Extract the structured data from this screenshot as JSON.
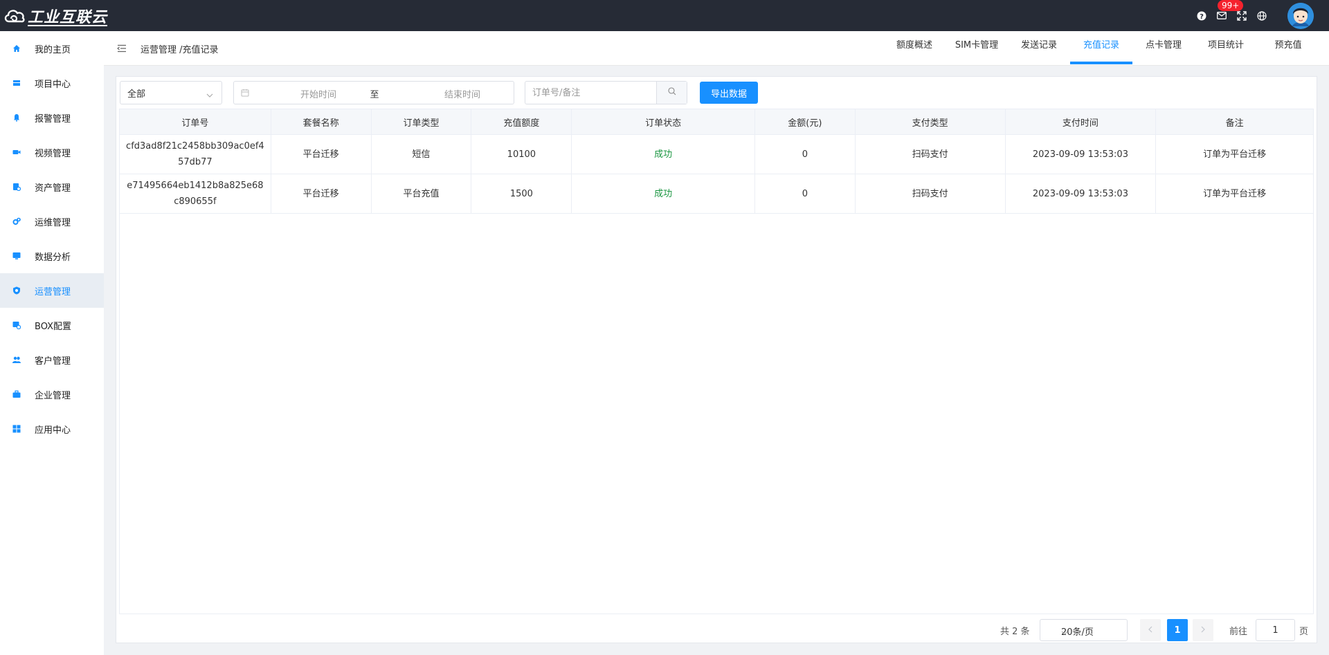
{
  "topbar": {
    "logo_text": "工业互联云",
    "notification_badge": "99+"
  },
  "sidebar": {
    "items": [
      {
        "label": "我的主页",
        "icon": "home-icon"
      },
      {
        "label": "项目中心",
        "icon": "project-icon"
      },
      {
        "label": "报警管理",
        "icon": "bell-icon"
      },
      {
        "label": "视频管理",
        "icon": "video-icon"
      },
      {
        "label": "资产管理",
        "icon": "asset-icon"
      },
      {
        "label": "运维管理",
        "icon": "gears-icon"
      },
      {
        "label": "数据分析",
        "icon": "monitor-icon"
      },
      {
        "label": "运营管理",
        "icon": "shield-icon"
      },
      {
        "label": "BOX配置",
        "icon": "box-config-icon"
      },
      {
        "label": "客户管理",
        "icon": "users-icon"
      },
      {
        "label": "企业管理",
        "icon": "briefcase-icon"
      },
      {
        "label": "应用中心",
        "icon": "apps-icon"
      }
    ],
    "active_index": 7
  },
  "header": {
    "breadcrumb": "运营管理 /充值记录",
    "tabs": [
      "额度概述",
      "SIM卡管理",
      "发送记录",
      "充值记录",
      "点卡管理",
      "项目统计",
      "预充值"
    ],
    "active_tab": 3
  },
  "filters": {
    "type_select": "全部",
    "start_placeholder": "开始时间",
    "range_separator": "至",
    "end_placeholder": "结束时间",
    "search_placeholder": "订单号/备注",
    "export_label": "导出数据"
  },
  "table": {
    "columns": [
      "订单号",
      "套餐名称",
      "订单类型",
      "充值额度",
      "订单状态",
      "金额(元)",
      "支付类型",
      "支付时间",
      "备注"
    ],
    "rows": [
      [
        "cfd3ad8f21c2458bb309ac0ef457db77",
        "平台迁移",
        "短信",
        "10100",
        "成功",
        "0",
        "扫码支付",
        "2023-09-09 13:53:03",
        "订单为平台迁移"
      ],
      [
        "e71495664eb1412b8a825e68c890655f",
        "平台迁移",
        "平台充值",
        "1500",
        "成功",
        "0",
        "扫码支付",
        "2023-09-09 13:53:03",
        "订单为平台迁移"
      ]
    ],
    "status_color": "#1a9641"
  },
  "pagination": {
    "total_text": "共 2 条",
    "page_size": "20条/页",
    "current_page": "1",
    "goto_label": "前往",
    "goto_value": "1",
    "goto_suffix": "页"
  },
  "colors": {
    "accent": "#1890ff",
    "topbar": "#262b36",
    "success": "#1a9641"
  }
}
